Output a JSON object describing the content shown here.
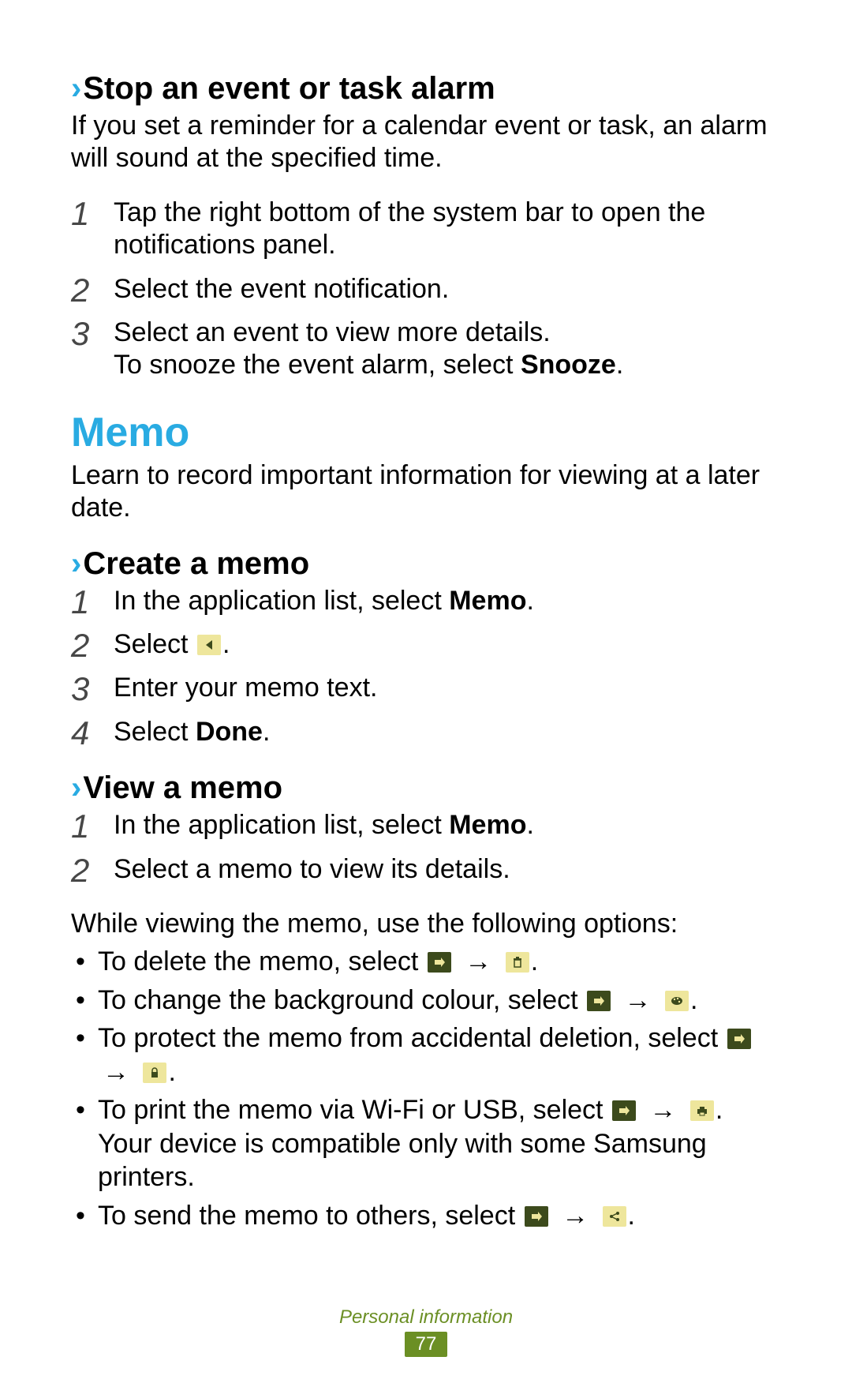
{
  "sections": {
    "stop_alarm": {
      "heading": "Stop an event or task alarm",
      "intro": "If you set a reminder for a calendar event or task, an alarm will sound at the specified time.",
      "steps": [
        "Tap the right bottom of the system bar to open the notifications panel.",
        "Select the event notification.",
        "Select an event to view more details.\nTo snooze the event alarm, select "
      ],
      "step3_bold": "Snooze"
    },
    "memo": {
      "heading": "Memo",
      "intro": "Learn to record important information for viewing at a later date."
    },
    "create_memo": {
      "heading": "Create a memo",
      "step1_pre": "In the application list, select ",
      "step1_bold": "Memo",
      "step2_pre": "Select ",
      "step3": "Enter your memo text.",
      "step4_pre": "Select ",
      "step4_bold": "Done"
    },
    "view_memo": {
      "heading": "View a memo",
      "step1_pre": "In the application list, select ",
      "step1_bold": "Memo",
      "step2": "Select a memo to view its details.",
      "options_intro": "While viewing the memo, use the following options:",
      "opt_delete_pre": "To delete the memo, select ",
      "opt_bg_pre": "To change the background colour, select ",
      "opt_protect_pre": "To protect the memo from accidental deletion, select ",
      "opt_print_pre": "To print the memo via Wi-Fi or USB, select ",
      "opt_print_post": ". Your device is compatible only with some Samsung printers.",
      "opt_send_pre": "To send the memo to others, select "
    }
  },
  "arrow": "→",
  "footer": {
    "section": "Personal information",
    "page": "77"
  }
}
